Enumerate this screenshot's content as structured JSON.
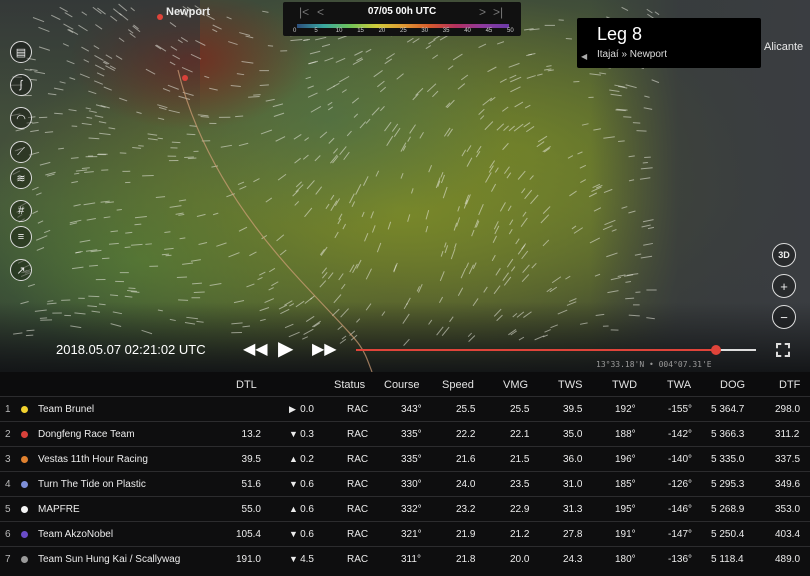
{
  "map": {
    "cities": [
      {
        "name": "Newport"
      },
      {
        "name": "Alicante"
      }
    ]
  },
  "timebar": {
    "date": "07/05 00h UTC",
    "scale_ticks": [
      "0",
      "5",
      "10",
      "15",
      "20",
      "25",
      "30",
      "35",
      "40",
      "45",
      "50"
    ]
  },
  "leg": {
    "title": "Leg 8",
    "route": "Itajaí » Newport"
  },
  "tools": {
    "left_icons": [
      "map-layers-icon",
      "route-icon",
      "compass-icon",
      "sail-icon",
      "wind-icon",
      "grid-icon",
      "bars-icon",
      "chart-icon"
    ],
    "right": {
      "view3d_label": "3D"
    }
  },
  "playback": {
    "timestamp": "2018.05.07 02:21:02 UTC",
    "coords": "13°33.18'N • 004°07.31'E",
    "progress": 0.9
  },
  "table": {
    "headers": {
      "dtl": "DTL",
      "status": "Status",
      "course": "Course",
      "speed": "Speed",
      "vmg": "VMG",
      "tws": "TWS",
      "twd": "TWD",
      "twa": "TWA",
      "dog": "DOG",
      "dtf": "DTF"
    },
    "rows": [
      {
        "rank": "1",
        "color": "#f2d22e",
        "name": "Team Brunel",
        "dtl": "",
        "trend": "right",
        "delta": "0.0",
        "status": "RAC",
        "course": "343°",
        "speed": "25.5",
        "vmg": "25.5",
        "tws": "39.5",
        "twd": "192°",
        "twa": "-155°",
        "dog": "5 364.7",
        "dtf": "298.0"
      },
      {
        "rank": "2",
        "color": "#d9413a",
        "name": "Dongfeng Race Team",
        "dtl": "13.2",
        "trend": "down",
        "delta": "0.3",
        "status": "RAC",
        "course": "335°",
        "speed": "22.2",
        "vmg": "22.1",
        "tws": "35.0",
        "twd": "188°",
        "twa": "-142°",
        "dog": "5 366.3",
        "dtf": "311.2"
      },
      {
        "rank": "3",
        "color": "#e0812f",
        "name": "Vestas 11th Hour Racing",
        "dtl": "39.5",
        "trend": "up",
        "delta": "0.2",
        "status": "RAC",
        "course": "335°",
        "speed": "21.6",
        "vmg": "21.5",
        "tws": "36.0",
        "twd": "196°",
        "twa": "-140°",
        "dog": "5 335.0",
        "dtf": "337.5"
      },
      {
        "rank": "4",
        "color": "#7e8fd8",
        "name": "Turn The Tide on Plastic",
        "dtl": "51.6",
        "trend": "down",
        "delta": "0.6",
        "status": "RAC",
        "course": "330°",
        "speed": "24.0",
        "vmg": "23.5",
        "tws": "31.0",
        "twd": "185°",
        "twa": "-126°",
        "dog": "5 295.3",
        "dtf": "349.6"
      },
      {
        "rank": "5",
        "color": "#f4f4f4",
        "name": "MAPFRE",
        "dtl": "55.0",
        "trend": "up",
        "delta": "0.6",
        "status": "RAC",
        "course": "332°",
        "speed": "23.2",
        "vmg": "22.9",
        "tws": "31.3",
        "twd": "195°",
        "twa": "-146°",
        "dog": "5 268.9",
        "dtf": "353.0"
      },
      {
        "rank": "6",
        "color": "#6a4cc8",
        "name": "Team AkzoNobel",
        "dtl": "105.4",
        "trend": "down",
        "delta": "0.6",
        "status": "RAC",
        "course": "321°",
        "speed": "21.9",
        "vmg": "21.2",
        "tws": "27.8",
        "twd": "191°",
        "twa": "-147°",
        "dog": "5 250.4",
        "dtf": "403.4"
      },
      {
        "rank": "7",
        "color": "#9a9a9a",
        "name": "Team Sun Hung Kai / Scallywag",
        "dtl": "191.0",
        "trend": "down",
        "delta": "4.5",
        "status": "RAC",
        "course": "311°",
        "speed": "21.8",
        "vmg": "20.0",
        "tws": "24.3",
        "twd": "180°",
        "twa": "-136°",
        "dog": "5 118.4",
        "dtf": "489.0"
      }
    ]
  }
}
